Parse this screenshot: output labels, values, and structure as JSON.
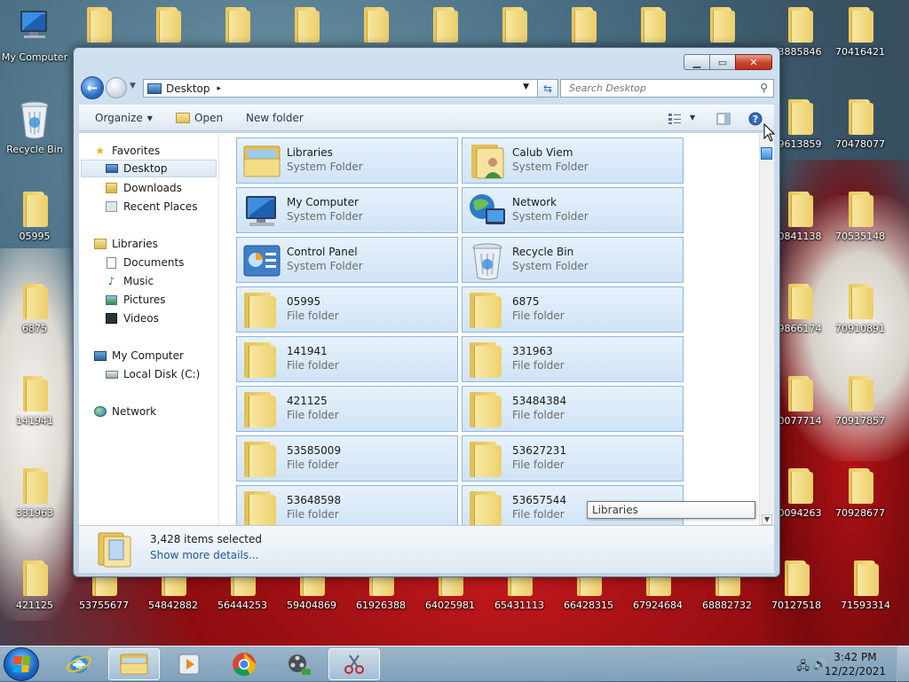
{
  "desktop": {
    "system_icons": [
      {
        "label": "My Computer"
      },
      {
        "label": "Recycle Bin"
      }
    ],
    "left_folders": [
      "05995",
      "6875",
      "141941",
      "331963",
      "421125"
    ],
    "bottom_folders": [
      "53755677",
      "54842882",
      "56444253",
      "59404869",
      "61926388",
      "64025981",
      "65431113",
      "66428315",
      "67924684",
      "68882732",
      "70127518",
      "71593314"
    ],
    "right_col1": [
      "3885846",
      "9613859",
      "0841138",
      "9866174",
      "0077714",
      "0094263"
    ],
    "right_col2": [
      "70416421",
      "70478077",
      "70535148",
      "70910891",
      "70917857",
      "70928677"
    ]
  },
  "window": {
    "caption": {
      "minimize": "▁",
      "maximize": "▭",
      "close": "✕"
    },
    "address": {
      "crumb": "Desktop",
      "sep": "▸",
      "dropdown": "▼",
      "nav_dropdown": "▼"
    },
    "search": {
      "placeholder": "Search Desktop"
    },
    "toolbar": {
      "organize": "Organize",
      "open": "Open",
      "new_folder": "New folder",
      "dropdown": "▼"
    },
    "nav_pane": {
      "favorites": "Favorites",
      "desktop": "Desktop",
      "downloads": "Downloads",
      "recent_places": "Recent Places",
      "libraries": "Libraries",
      "documents": "Documents",
      "music": "Music",
      "pictures": "Pictures",
      "videos": "Videos",
      "my_computer": "My Computer",
      "local_disk": "Local Disk (C:)",
      "network": "Network"
    },
    "tiles": [
      {
        "name": "Libraries",
        "type": "System Folder",
        "icon": "libraries-icon"
      },
      {
        "name": "Calub Viem",
        "type": "System Folder",
        "icon": "user-folder-icon"
      },
      {
        "name": "My Computer",
        "type": "System Folder",
        "icon": "computer-icon"
      },
      {
        "name": "Network",
        "type": "System Folder",
        "icon": "network-icon"
      },
      {
        "name": "Control Panel",
        "type": "System Folder",
        "icon": "control-panel-icon"
      },
      {
        "name": "Recycle Bin",
        "type": "System Folder",
        "icon": "recycle-bin-icon"
      },
      {
        "name": "05995",
        "type": "File folder",
        "icon": "folder-icon"
      },
      {
        "name": "6875",
        "type": "File folder",
        "icon": "folder-icon"
      },
      {
        "name": "141941",
        "type": "File folder",
        "icon": "folder-icon"
      },
      {
        "name": "331963",
        "type": "File folder",
        "icon": "folder-icon"
      },
      {
        "name": "421125",
        "type": "File folder",
        "icon": "folder-icon"
      },
      {
        "name": "53484384",
        "type": "File folder",
        "icon": "folder-icon"
      },
      {
        "name": "53585009",
        "type": "File folder",
        "icon": "folder-icon"
      },
      {
        "name": "53627231",
        "type": "File folder",
        "icon": "folder-icon"
      },
      {
        "name": "53648598",
        "type": "File folder",
        "icon": "folder-icon"
      },
      {
        "name": "53657544",
        "type": "File folder",
        "icon": "folder-icon"
      }
    ],
    "tooltip": "Libraries",
    "details": {
      "count": "3,428 items selected",
      "more": "Show more details..."
    }
  },
  "taskbar": {
    "time": "3:42 PM",
    "date": "12/22/2021"
  }
}
